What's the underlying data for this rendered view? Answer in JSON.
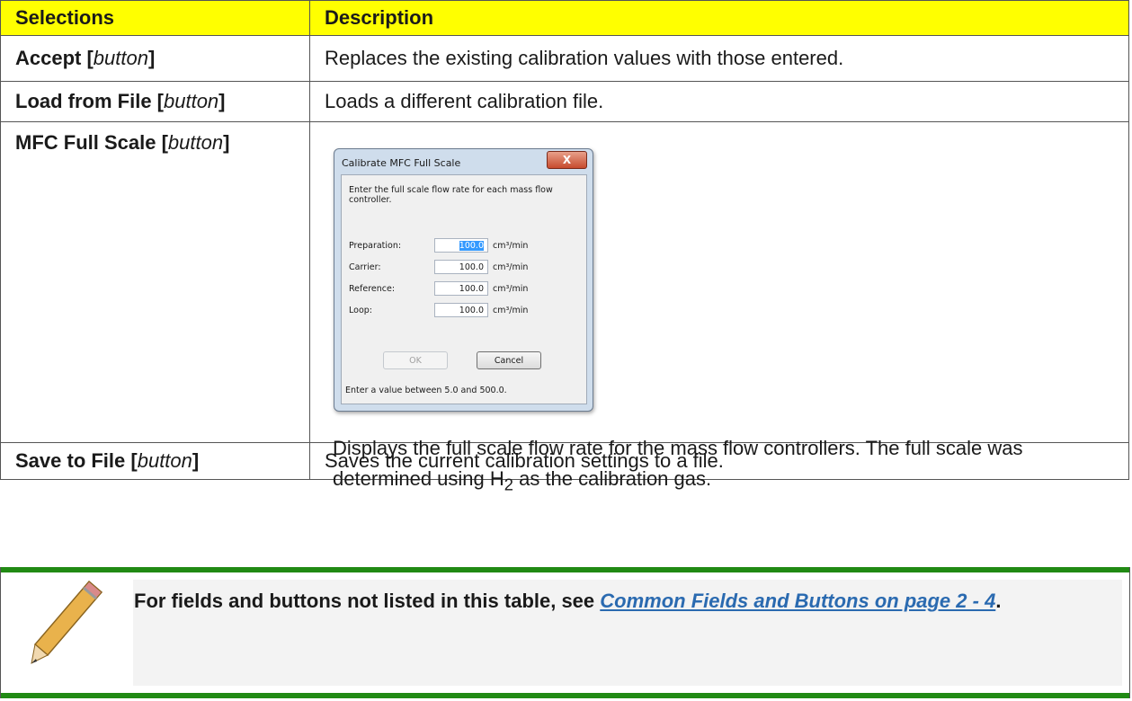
{
  "table": {
    "headers": [
      "Selections",
      "Description"
    ],
    "rows": [
      {
        "label": "Accept [",
        "label_italic": "button",
        "label_end": "]",
        "description": "Replaces the existing calibration values with those entered."
      },
      {
        "label": "Load from File [",
        "label_italic": "button",
        "label_end": "]",
        "description": "Loads a different calibration file."
      },
      {
        "label": "MFC Full Scale [",
        "label_italic": "button",
        "label_end": "]",
        "description_part1": "Displays the full scale flow rate for the mass flow controllers. The full scale was determined using H",
        "description_sub": "2",
        "description_part2": " as the calibration gas."
      },
      {
        "label": "Save to File [",
        "label_italic": "button",
        "label_end": "]",
        "description": "Saves the current calibration settings to a file."
      }
    ]
  },
  "dialog": {
    "title": "Calibrate MFC Full Scale",
    "close": "X",
    "instructions": "Enter the full scale flow rate for each mass flow controller.",
    "fields": [
      {
        "label": "Preparation:",
        "value": "100.0",
        "unit": "cm³/min"
      },
      {
        "label": "Carrier:",
        "value": "100.0",
        "unit": "cm³/min"
      },
      {
        "label": "Reference:",
        "value": "100.0",
        "unit": "cm³/min"
      },
      {
        "label": "Loop:",
        "value": "100.0",
        "unit": "cm³/min"
      }
    ],
    "ok_label": "OK",
    "cancel_label": "Cancel",
    "status": "Enter a value between 5.0 and 500.0."
  },
  "note": {
    "text_before": "For fields and buttons not listed in this table, see ",
    "link": "Common Fields and Buttons on page 2 - 4",
    "text_after": "."
  },
  "colors": {
    "header_bg": "#ffff00",
    "note_bar": "#218a14",
    "link": "#2a6ab0"
  }
}
